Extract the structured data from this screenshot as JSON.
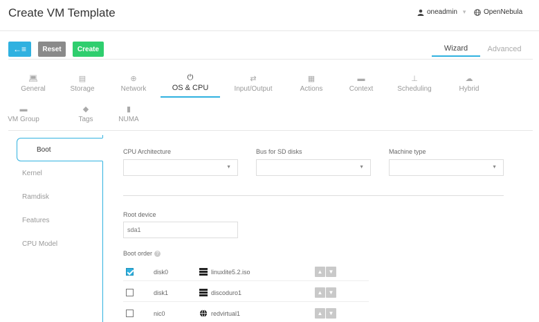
{
  "header": {
    "title": "Create VM Template",
    "user": "oneadmin",
    "zone": "OpenNebula"
  },
  "toolbar": {
    "back_label": "←≡",
    "reset_label": "Reset",
    "create_label": "Create",
    "mode_tabs": [
      "Wizard",
      "Advanced"
    ]
  },
  "tabs": [
    {
      "label": "General",
      "icon": "laptop-icon"
    },
    {
      "label": "Storage",
      "icon": "storage-icon"
    },
    {
      "label": "Network",
      "icon": "globe-icon"
    },
    {
      "label": "OS & CPU",
      "icon": "power-icon"
    },
    {
      "label": "Input/Output",
      "icon": "exchange-icon"
    },
    {
      "label": "Actions",
      "icon": "calendar-icon"
    },
    {
      "label": "Context",
      "icon": "folder-icon"
    },
    {
      "label": "Scheduling",
      "icon": "sitemap-icon"
    },
    {
      "label": "Hybrid",
      "icon": "cloud-icon"
    },
    {
      "label": "VM Group",
      "icon": "folder-icon"
    },
    {
      "label": "Tags",
      "icon": "tag-icon"
    },
    {
      "label": "NUMA",
      "icon": "chip-icon"
    }
  ],
  "active_tab": "OS & CPU",
  "subtabs": [
    "Boot",
    "Kernel",
    "Ramdisk",
    "Features",
    "CPU Model"
  ],
  "form": {
    "cpu_arch_label": "CPU Architecture",
    "bus_sd_label": "Bus for SD disks",
    "machine_type_label": "Machine type",
    "root_device_label": "Root device",
    "root_device_placeholder": "sda1",
    "boot_order_label": "Boot order"
  },
  "boot_order": [
    {
      "device": "disk0",
      "checked": true,
      "resource": "linuxlite5.2.iso",
      "icon": "disk-image-icon"
    },
    {
      "device": "disk1",
      "checked": false,
      "resource": "discoduro1",
      "icon": "disk-image-icon"
    },
    {
      "device": "nic0",
      "checked": false,
      "resource": "redvirtual1",
      "icon": "globe-icon"
    }
  ],
  "colors": {
    "accent": "#2fb1e0",
    "create": "#2fce6e",
    "reset": "#8a8a8a"
  }
}
